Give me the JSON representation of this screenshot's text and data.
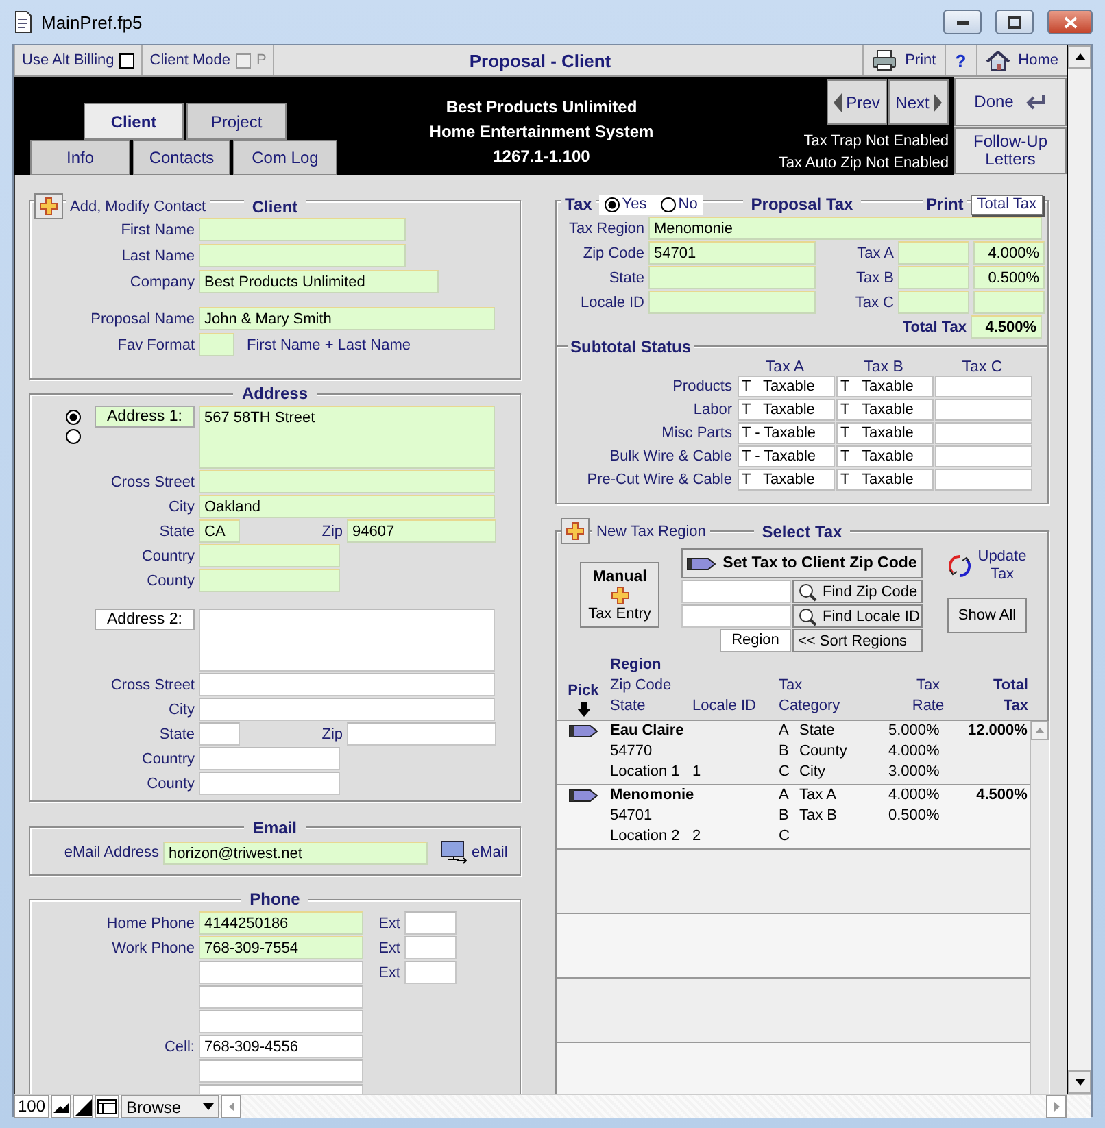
{
  "window": {
    "title": "MainPref.fp5"
  },
  "toolbar": {
    "alt_billing": {
      "label": "Use Alt Billing",
      "checked": false,
      "disabled": false
    },
    "client_mode": {
      "label": "Client Mode",
      "checked": false,
      "disabled": true,
      "suffix": "P"
    },
    "title": "Proposal - Client",
    "print": "Print",
    "help": "?",
    "home": "Home"
  },
  "header": {
    "tabs_top": [
      {
        "label": "Client",
        "selected": true
      },
      {
        "label": "Project",
        "selected": false
      }
    ],
    "tabs_bottom": [
      {
        "label": "Info",
        "selected": false
      },
      {
        "label": "Contacts",
        "selected": false
      },
      {
        "label": "Com Log",
        "selected": false
      }
    ],
    "lines": [
      "Best Products Unlimited",
      "Home Entertainment System",
      "1267.1-1.100"
    ],
    "prev": "Prev",
    "next": "Next",
    "notices": [
      "Tax Trap Not Enabled",
      "Tax Auto Zip Not Enabled"
    ],
    "done": "Done",
    "follow_up": "Follow-Up Letters"
  },
  "client": {
    "add_label": "Add, Modify Contact",
    "title": "Client",
    "fields": [
      {
        "label": "First Name",
        "highlighted": true
      },
      {
        "label": "Last Name",
        "highlighted": true
      },
      {
        "label": "Company",
        "value": "Best Products Unlimited",
        "highlighted": true
      },
      {
        "label": "Proposal Name",
        "value": "John & Mary Smith",
        "highlighted": true
      },
      {
        "label": "Fav Format",
        "highlighted": true,
        "note": "First Name + Last Name"
      }
    ]
  },
  "address": {
    "title": "Address",
    "selectors": [
      {
        "selected": true
      },
      {
        "selected": false
      }
    ],
    "blocks": [
      {
        "label": "Address 1:",
        "highlighted": true,
        "street": "567 58TH Street",
        "fields": [
          {
            "label": "Cross Street"
          },
          {
            "label": "City",
            "value": "Oakland"
          },
          {
            "label": "State",
            "value": "CA"
          },
          {
            "label": "Zip",
            "value": "94607"
          },
          {
            "label": "Country"
          },
          {
            "label": "County"
          }
        ]
      },
      {
        "label": "Address 2:",
        "highlighted": false,
        "fields": [
          {
            "label": "Cross Street"
          },
          {
            "label": "City"
          },
          {
            "label": "State"
          },
          {
            "label": "Zip"
          },
          {
            "label": "Country"
          },
          {
            "label": "County"
          }
        ]
      }
    ]
  },
  "email": {
    "title": "Email",
    "label": "eMail Address",
    "value": "horizon@triwest.net",
    "highlighted": true,
    "button": "eMail"
  },
  "phone": {
    "title": "Phone",
    "rows": [
      {
        "label": "Home Phone",
        "value": "4144250186",
        "highlighted": true,
        "ext": "Ext"
      },
      {
        "label": "Work Phone",
        "value": "768-309-7554",
        "highlighted": true,
        "ext": "Ext"
      },
      {
        "highlighted": false,
        "ext": "Ext"
      },
      {
        "highlighted": false
      },
      {
        "highlighted": false
      },
      {
        "label": "Cell:",
        "value": "768-309-4556",
        "highlighted": false
      },
      {
        "highlighted": false
      },
      {
        "highlighted": false
      }
    ]
  },
  "proposal_tax": {
    "tax_label": "Tax",
    "options": [
      {
        "label": "Yes",
        "selected": true
      },
      {
        "label": "No",
        "selected": false
      }
    ],
    "title": "Proposal Tax",
    "print_label": "Print",
    "print_button": "Total Tax",
    "region": {
      "label": "Tax Region",
      "value": "Menomonie"
    },
    "left_fields": [
      {
        "label": "Zip Code",
        "value": "54701"
      },
      {
        "label": "State"
      },
      {
        "label": "Locale ID"
      }
    ],
    "rates": [
      {
        "label": "Tax A",
        "value": "4.000%"
      },
      {
        "label": "Tax B",
        "value": "0.500%"
      },
      {
        "label": "Tax C"
      }
    ],
    "total": {
      "label": "Total Tax",
      "value": "4.500%"
    }
  },
  "subtotal_status": {
    "title": "Subtotal Status",
    "columns": [
      "Tax A",
      "Tax B",
      "Tax C"
    ],
    "rows": [
      {
        "label": "Products",
        "cells": [
          "T   Taxable",
          "T   Taxable"
        ]
      },
      {
        "label": "Labor",
        "cells": [
          "T   Taxable",
          "T   Taxable"
        ]
      },
      {
        "label": "Misc Parts",
        "cells": [
          "T - Taxable",
          "T   Taxable"
        ]
      },
      {
        "label": "Bulk Wire & Cable",
        "cells": [
          "T - Taxable",
          "T   Taxable"
        ]
      },
      {
        "label": "Pre-Cut Wire & Cable",
        "cells": [
          "T   Taxable",
          "T   Taxable"
        ]
      }
    ]
  },
  "select_tax": {
    "add_label": "New Tax Region",
    "title": "Select Tax",
    "manual_button": {
      "title": "Manual",
      "label": "Tax Entry"
    },
    "set_button": "Set Tax to Client Zip Code",
    "find_zip": "Find Zip Code",
    "find_locale": "Find Locale ID",
    "region_label": "Region",
    "sort_button": "<< Sort Regions",
    "update": "Update Tax",
    "show_all": "Show All",
    "headers": {
      "pick": "Pick",
      "region": [
        "**Region**",
        "Zip Code",
        "State"
      ],
      "locale": "Locale ID",
      "category": [
        "Tax",
        "Category"
      ],
      "rate": [
        "Tax",
        "Rate"
      ],
      "total": [
        "Total",
        "Tax"
      ]
    },
    "rows": [
      {
        "region": "Eau Claire",
        "zip": "54770",
        "location": "Location 1",
        "locale": "1",
        "total": "12.000%",
        "taxes": [
          {
            "code": "A",
            "name": "State",
            "rate": "5.000%"
          },
          {
            "code": "B",
            "name": "County",
            "rate": "4.000%"
          },
          {
            "code": "C",
            "name": "City",
            "rate": "3.000%"
          }
        ]
      },
      {
        "region": "Menomonie",
        "zip": "54701",
        "location": "Location 2",
        "locale": "2",
        "total": "4.500%",
        "taxes": [
          {
            "code": "A",
            "name": "Tax A",
            "rate": "4.000%"
          },
          {
            "code": "B",
            "name": "Tax B",
            "rate": "0.500%"
          },
          {
            "code": "C"
          }
        ]
      }
    ]
  },
  "status_bar": {
    "zoom": "100",
    "mode": "Browse"
  }
}
